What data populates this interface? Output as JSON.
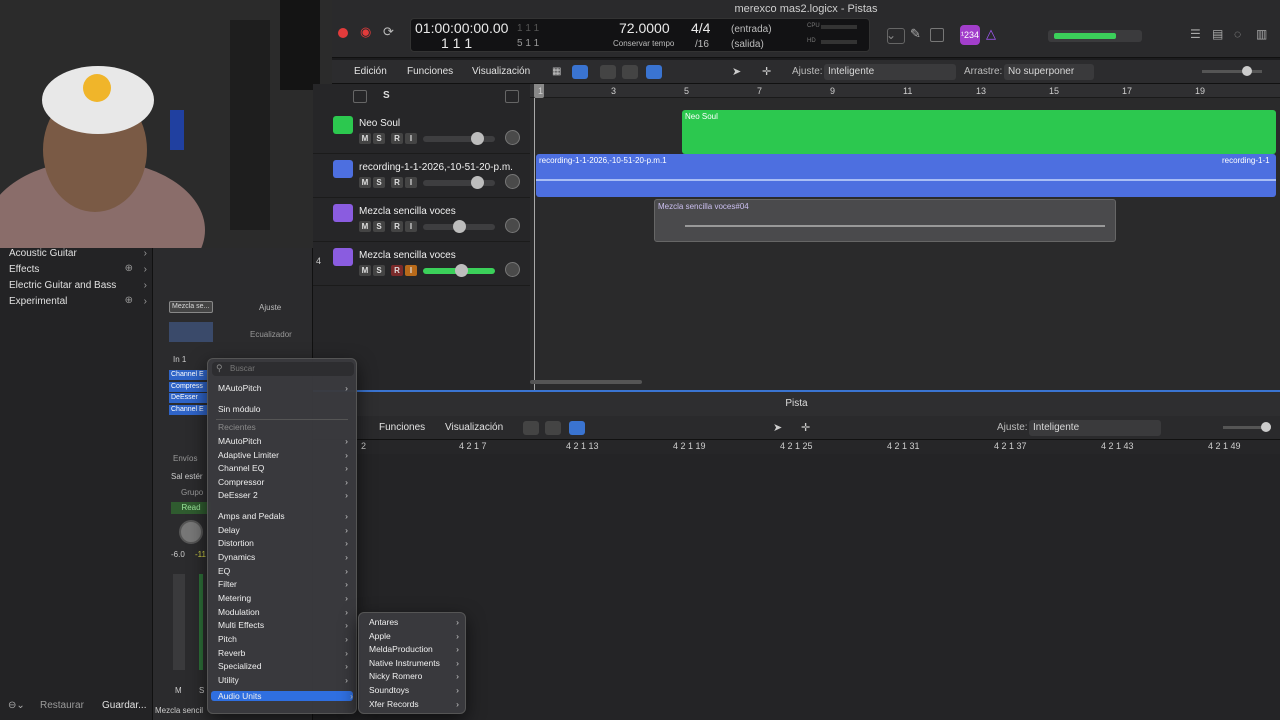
{
  "window": {
    "title": "merexco mas2.logicx - Pistas"
  },
  "lcd": {
    "time": "01:00:00:00.00",
    "bars_a": "1 1 1",
    "bars_dim": "1",
    "tempo": "72.0000",
    "tempo_label": "Conservar tempo",
    "sig": "4/4",
    "div": "/16",
    "in": "(entrada)",
    "out": "(salida)",
    "cpu": "CPU",
    "hd": "HD",
    "row2_left": "1  1  1",
    "row2_right": "5  1  1"
  },
  "title_badge": "¹234",
  "toolbar": {
    "edicion": "Edición",
    "funciones": "Funciones",
    "visualizacion": "Visualización",
    "ajuste_label": "Ajuste:",
    "ajuste_value": "Inteligente",
    "arrastrar_label": "Arrastre:",
    "arrastrar_value": "No superponer"
  },
  "ruler": [
    "1",
    "3",
    "5",
    "7",
    "9",
    "11",
    "13",
    "15",
    "17",
    "19"
  ],
  "tracks": [
    {
      "num": "",
      "name": "Neo Soul",
      "color": "#2cc84f"
    },
    {
      "num": "",
      "name": "recording-1-1-2026,-10-51-20-p.m.",
      "color": "#4d6fe0"
    },
    {
      "num": "",
      "name": "Mezcla sencilla voces",
      "color": "#8a5ce0"
    },
    {
      "num": "4",
      "name": "Mezcla sencilla voces",
      "color": "#8a5ce0"
    }
  ],
  "track_buttons": {
    "m": "M",
    "s": "S",
    "r": "R",
    "i": "I"
  },
  "header_s": "S",
  "regions": {
    "neo_soul": "Neo Soul",
    "recording": "recording-1-1-2026,-10-51-20-p.m.1",
    "recording_end": "recording-1-1",
    "mezcla": "Mezcla sencilla voces#04"
  },
  "library": {
    "items": [
      {
        "label": "Acoustic Guitar",
        "plus": false
      },
      {
        "label": "Effects",
        "plus": true
      },
      {
        "label": "Electric Guitar and Bass",
        "plus": false
      },
      {
        "label": "Experimental",
        "plus": true
      }
    ],
    "restore": "Restaurar",
    "save": "Guardar..."
  },
  "inspector": {
    "region_name": "Mezcla se...",
    "ajuste": "Ajuste",
    "ecualizador": "Ecualizador",
    "input": "In 1",
    "plugins": [
      "Channel E",
      "Compress",
      "DeEsser",
      "Channel E"
    ],
    "envios": "Envíos",
    "sal": "Sal estér",
    "grupo": "Grupo",
    "read": "Read",
    "vol": "-6.0",
    "peak": "-11",
    "m": "M",
    "s": "S",
    "footer_name": "Mezcla sencil"
  },
  "editor": {
    "title": "Pista",
    "funciones": "Funciones",
    "visualizacion": "Visualización",
    "ajuste_label": "Ajuste:",
    "ajuste_value": "Inteligente",
    "ruler": [
      "2",
      "4 2 1 7",
      "4 2 1 13",
      "4 2 1 19",
      "4 2 1 25",
      "4 2 1 31",
      "4 2 1 37",
      "4 2 1 43",
      "4 2 1 49"
    ]
  },
  "plugin_menu": {
    "search_placeholder": "Buscar",
    "top": [
      "MAutoPitch",
      "Sin módulo"
    ],
    "recent_header": "Recientes",
    "recent": [
      "MAutoPitch",
      "Adaptive Limiter",
      "Channel EQ",
      "Compressor",
      "DeEsser 2"
    ],
    "categories": [
      "Amps and Pedals",
      "Delay",
      "Distortion",
      "Dynamics",
      "EQ",
      "Filter",
      "Metering",
      "Modulation",
      "Multi Effects",
      "Pitch",
      "Reverb",
      "Specialized",
      "Utility"
    ],
    "audio_units": "Audio Units"
  },
  "au_menu": {
    "items": [
      "Antares",
      "Apple",
      "MeldaProduction",
      "Native Instruments",
      "Nicky Romero",
      "Soundtoys",
      "Xfer Records"
    ]
  }
}
